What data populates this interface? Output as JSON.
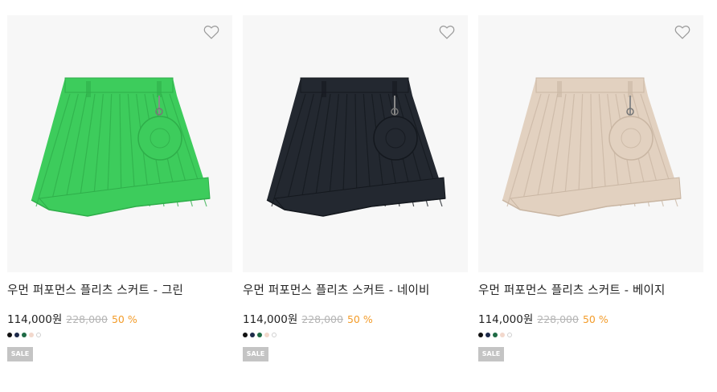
{
  "products": [
    {
      "name": "우먼 퍼포먼스 플리츠 스커트 - 그린",
      "price": "114,000원",
      "original_price": "228,000",
      "discount": "50 %",
      "badge": "SALE",
      "skirt_color": "#3dcc5c",
      "skirt_shade": "#2fae4a",
      "colors": [
        "#111111",
        "#1d2a4a",
        "#1f6b45",
        "#f2d8cc",
        "#ffffff"
      ]
    },
    {
      "name": "우먼 퍼포먼스 플리츠 스커트 - 네이비",
      "price": "114,000원",
      "original_price": "228,000",
      "discount": "50 %",
      "badge": "SALE",
      "skirt_color": "#232830",
      "skirt_shade": "#14181e",
      "colors": [
        "#111111",
        "#1d2a4a",
        "#1f6b45",
        "#f2d8cc",
        "#ffffff"
      ]
    },
    {
      "name": "우먼 퍼포먼스 플리츠 스커트 - 베이지",
      "price": "114,000원",
      "original_price": "228,000",
      "discount": "50 %",
      "badge": "SALE",
      "skirt_color": "#e2d1c0",
      "skirt_shade": "#c9b6a3",
      "colors": [
        "#111111",
        "#1d2a4a",
        "#1f6b45",
        "#f2d8cc",
        "#ffffff"
      ]
    }
  ]
}
